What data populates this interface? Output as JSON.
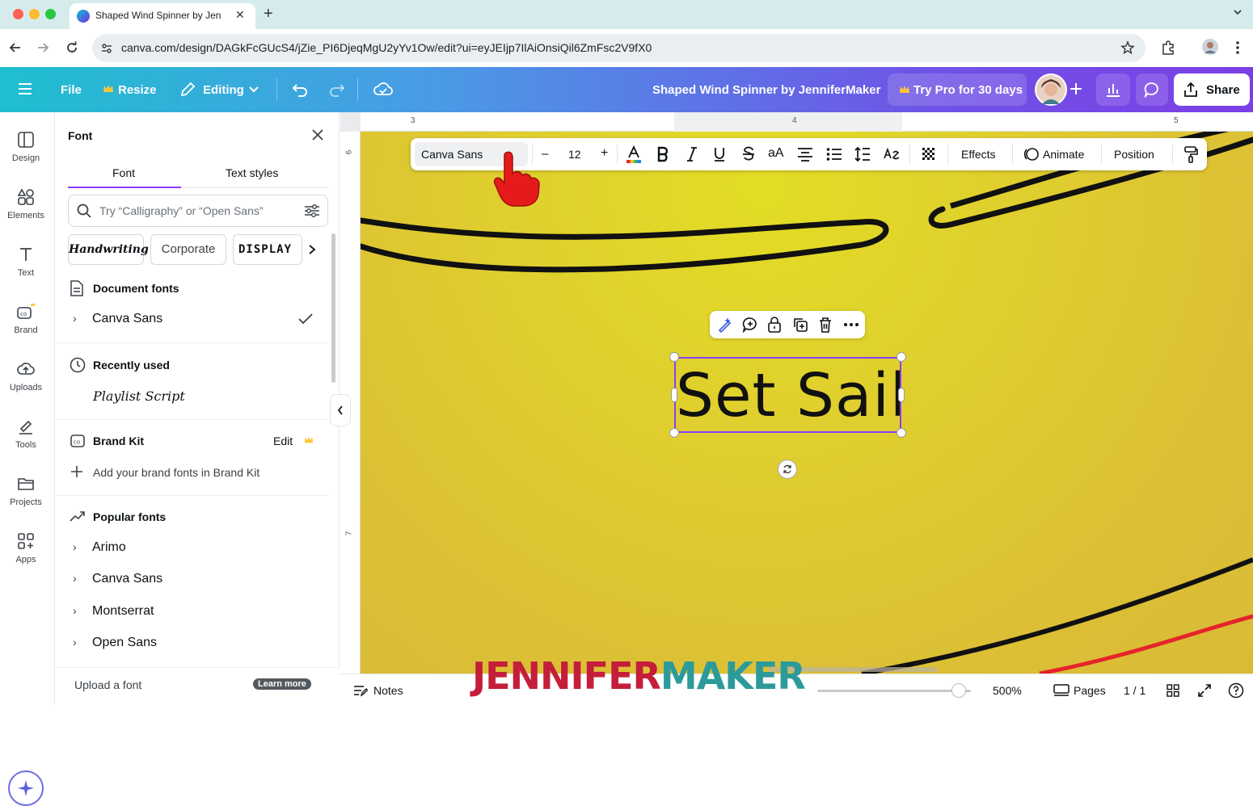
{
  "browser": {
    "tab_title": "Shaped Wind Spinner by Jen",
    "url": "canva.com/design/DAGkFcGUcS4/jZie_PI6DjeqMgU2yYv1Ow/edit?ui=eyJEIjp7IlAiOnsiQil6ZmFsc2V9fX0"
  },
  "header": {
    "file_label": "File",
    "resize_label": "Resize",
    "editing_label": "Editing",
    "doc_title": "Shaped Wind Spinner by JenniferMaker",
    "try_pro_label": "Try Pro for 30 days",
    "share_label": "Share"
  },
  "rail": {
    "items": [
      {
        "label": "Design",
        "icon": "design-icon"
      },
      {
        "label": "Elements",
        "icon": "elements-icon"
      },
      {
        "label": "Text",
        "icon": "text-icon"
      },
      {
        "label": "Brand",
        "icon": "brand-icon"
      },
      {
        "label": "Uploads",
        "icon": "uploads-icon"
      },
      {
        "label": "Tools",
        "icon": "tools-icon"
      },
      {
        "label": "Projects",
        "icon": "projects-icon"
      },
      {
        "label": "Apps",
        "icon": "apps-icon"
      }
    ]
  },
  "panel": {
    "title": "Font",
    "tabs": [
      "Font",
      "Text styles"
    ],
    "search_placeholder": "Try “Calligraphy” or “Open Sans”",
    "chips": [
      "Handwriting",
      "Corporate",
      "DISPLAY"
    ],
    "document_fonts_heading": "Document fonts",
    "document_fonts": [
      "Canva Sans"
    ],
    "recently_used_heading": "Recently used",
    "recently_used": [
      "Playlist Script"
    ],
    "brand_kit_heading": "Brand Kit",
    "brand_kit_edit": "Edit",
    "brand_kit_add": "Add your brand fonts in Brand Kit",
    "popular_heading": "Popular fonts",
    "popular_fonts": [
      "Arimo",
      "Canva Sans",
      "Montserrat",
      "Open Sans"
    ],
    "upload_label": "Upload a font",
    "learn_more": "Learn more"
  },
  "format_bar": {
    "font_name": "Canva Sans",
    "minus": "–",
    "font_size": "12",
    "plus": "+",
    "case_label": "aA",
    "effects_label": "Effects",
    "animate_label": "Animate",
    "position_label": "Position"
  },
  "canvas": {
    "text": "Set Sail",
    "ruler_h": [
      "3",
      "4",
      "5"
    ],
    "ruler_v": [
      "6",
      "7"
    ]
  },
  "bottom": {
    "notes_label": "Notes",
    "zoom_level": "500%",
    "zoom_fraction": 0.92,
    "pages_label": "Pages",
    "page_count": "1 / 1"
  },
  "watermark": {
    "part1": "JENNIFER",
    "part2": "MAKER"
  },
  "colors": {
    "brand_purple": "#8b3dff",
    "canvas_yellow": "#dcc232",
    "watermark_red": "#c41e3a",
    "watermark_teal": "#2d9a9a"
  }
}
